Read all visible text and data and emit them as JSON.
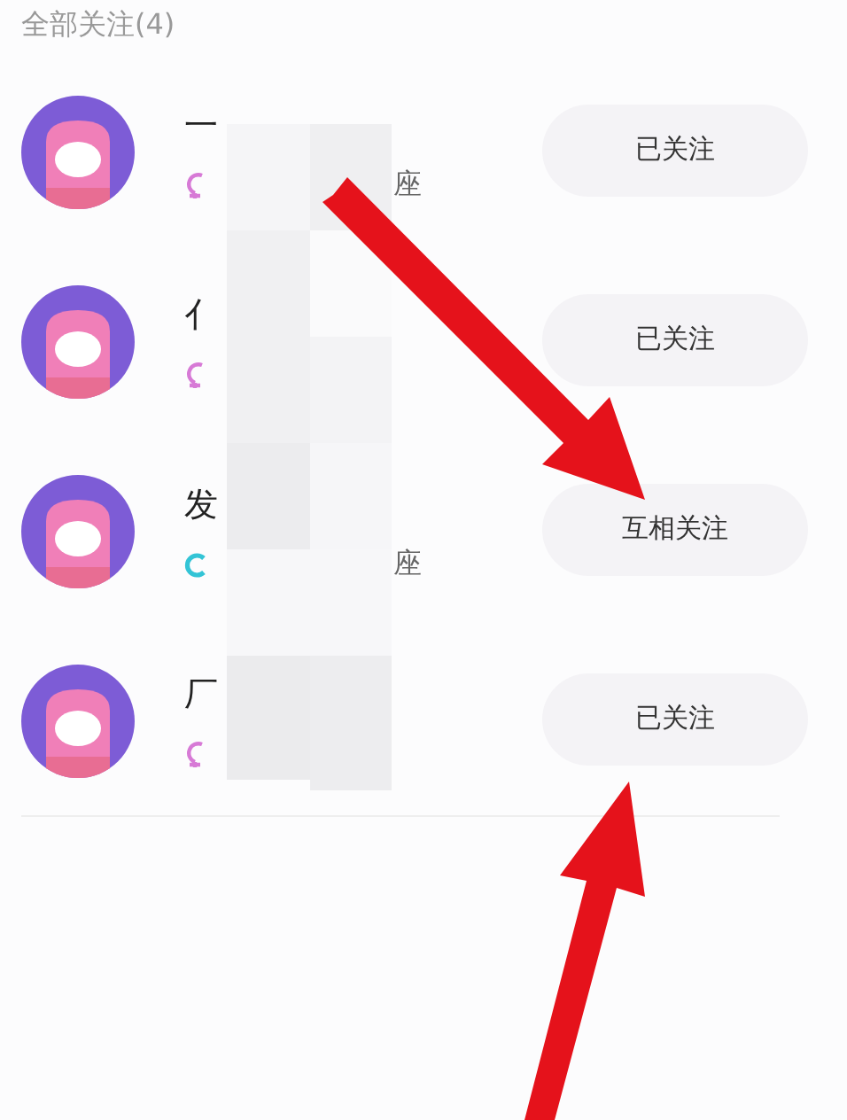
{
  "header": {
    "title": "全部关注(4)"
  },
  "users": [
    {
      "name": "一",
      "kind": "female",
      "constellation": "座",
      "button": "已关注"
    },
    {
      "name": "亻",
      "kind": "female",
      "button": "已关注"
    },
    {
      "name": "发",
      "kind": "male",
      "constellation": "座",
      "button": "互相关注"
    },
    {
      "name": "厂",
      "kind": "female",
      "button": "已关注"
    }
  ]
}
